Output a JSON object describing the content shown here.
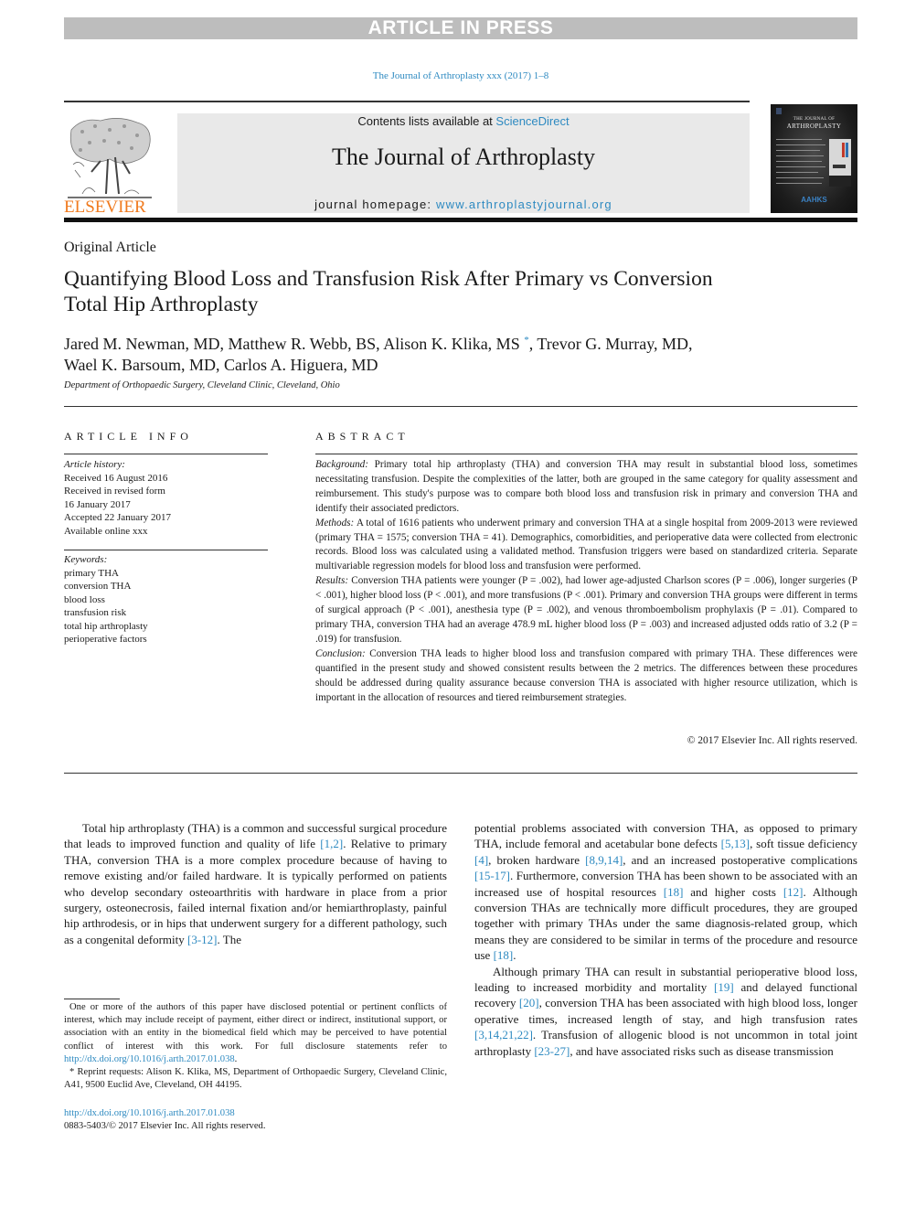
{
  "banner": {
    "text": "ARTICLE IN PRESS"
  },
  "journal_ref": "The Journal of Arthroplasty xxx (2017) 1–8",
  "masthead": {
    "publisher": "ELSEVIER",
    "contents_prefix": "Contents lists available at ",
    "contents_link": "ScienceDirect",
    "journal_name": "The Journal of Arthroplasty",
    "homepage_prefix": "journal homepage: ",
    "homepage_link": "www.arthroplastyjournal.org",
    "cover_title_1": "THE JOURNAL OF",
    "cover_title_2": "ARTHROPLASTY",
    "cover_society": "AAHKS"
  },
  "article": {
    "type": "Original Article",
    "title": "Quantifying Blood Loss and Transfusion Risk After Primary vs Conversion Total Hip Arthroplasty",
    "authors_line1_a": "Jared M. Newman, MD, Matthew R. Webb, BS, Alison K. Klika, MS ",
    "authors_mark": "*",
    "authors_line1_b": ", Trevor G. Murray, MD,",
    "authors_line2": "Wael K. Barsoum, MD,  Carlos A. Higuera, MD",
    "affiliation": "Department of Orthopaedic Surgery, Cleveland Clinic, Cleveland, Ohio"
  },
  "article_info": {
    "heading": "ARTICLE INFO",
    "history_label": "Article history:",
    "history": [
      "Received 16 August 2016",
      "Received in revised form",
      "16 January 2017",
      "Accepted 22 January 2017",
      "Available online xxx"
    ],
    "keywords_label": "Keywords:",
    "keywords": [
      "primary THA",
      "conversion THA",
      "blood loss",
      "transfusion risk",
      "total hip arthroplasty",
      "perioperative factors"
    ]
  },
  "abstract": {
    "heading": "ABSTRACT",
    "background_label": "Background:",
    "background": "Primary total hip arthroplasty (THA) and conversion THA may result in substantial blood loss, sometimes necessitating transfusion. Despite the complexities of the latter, both are grouped in the same category for quality assessment and reimbursement. This study's purpose was to compare both blood loss and transfusion risk in primary and conversion THA and identify their associated predictors.",
    "methods_label": "Methods:",
    "methods": "A total of 1616 patients who underwent primary and conversion THA at a single hospital from 2009-2013 were reviewed (primary THA = 1575; conversion THA = 41). Demographics, comorbidities, and perioperative data were collected from electronic records. Blood loss was calculated using a validated method. Transfusion triggers were based on standardized criteria. Separate multivariable regression models for blood loss and transfusion were performed.",
    "results_label": "Results:",
    "results": "Conversion THA patients were younger (P = .002), had lower age-adjusted Charlson scores (P = .006), longer surgeries (P < .001), higher blood loss (P < .001), and more transfusions (P < .001). Primary and conversion THA groups were different in terms of surgical approach (P < .001), anesthesia type (P = .002), and venous thromboembolism prophylaxis (P = .01). Compared to primary THA, conversion THA had an average 478.9 mL higher blood loss (P = .003) and increased adjusted odds ratio of 3.2 (P = .019) for transfusion.",
    "conclusion_label": "Conclusion:",
    "conclusion": "Conversion THA leads to higher blood loss and transfusion compared with primary THA. These differences were quantified in the present study and showed consistent results between the 2 metrics. The differences between these procedures should be addressed during quality assurance because conversion THA is associated with higher resource utilization, which is important in the allocation of resources and tiered reimbursement strategies.",
    "copyright": "© 2017 Elsevier Inc. All rights reserved."
  },
  "body": {
    "left_p1": [
      {
        "t": "Total hip arthroplasty (THA) is a common and successful surgical procedure that leads to improved function and quality of life "
      },
      {
        "ref": "[1,2]"
      },
      {
        "t": ". Relative to primary THA, conversion THA is a more complex procedure because of having to remove existing and/or failed hardware. It is typically performed on patients who develop secondary osteoarthritis with hardware in place from a prior surgery, osteonecrosis, failed internal fixation and/or hemiarthroplasty, painful hip arthrodesis, or in hips that underwent surgery for a different pathology, such as a congenital deformity "
      },
      {
        "ref": "[3-12]"
      },
      {
        "t": ". The"
      }
    ],
    "right_p1": [
      {
        "t": "potential problems associated with conversion THA, as opposed to primary THA, include femoral and acetabular bone defects "
      },
      {
        "ref": "[5,13]"
      },
      {
        "t": ", soft tissue deficiency "
      },
      {
        "ref": "[4]"
      },
      {
        "t": ", broken hardware "
      },
      {
        "ref": "[8,9,14]"
      },
      {
        "t": ", and an increased postoperative complications "
      },
      {
        "ref": "[15-17]"
      },
      {
        "t": ". Furthermore, conversion THA has been shown to be associated with an increased use of hospital resources "
      },
      {
        "ref": "[18]"
      },
      {
        "t": " and higher costs "
      },
      {
        "ref": "[12]"
      },
      {
        "t": ". Although conversion THAs are technically more difficult procedures, they are grouped together with primary THAs under the same diagnosis-related group, which means they are considered to be similar in terms of the procedure and resource use "
      },
      {
        "ref": "[18]"
      },
      {
        "t": "."
      }
    ],
    "right_p2": [
      {
        "t": "Although primary THA can result in substantial perioperative blood loss, leading to increased morbidity and mortality "
      },
      {
        "ref": "[19]"
      },
      {
        "t": " and delayed functional recovery "
      },
      {
        "ref": "[20]"
      },
      {
        "t": ", conversion THA has been associated with high blood loss, longer operative times, increased length of stay, and high transfusion rates "
      },
      {
        "ref": "[3,14,21,22]"
      },
      {
        "t": ". Transfusion of allogenic blood is not uncommon in total joint arthroplasty "
      },
      {
        "ref": "[23-27]"
      },
      {
        "t": ", and have associated risks such as disease transmission"
      }
    ]
  },
  "footnotes": {
    "coi_text": "One or more of the authors of this paper have disclosed potential or pertinent conflicts of interest, which may include receipt of payment, either direct or indirect, institutional support, or association with an entity in the biomedical field which may be perceived to have potential conflict of interest with this work. For full disclosure statements refer to ",
    "coi_link": "http://dx.doi.org/10.1016/j.arth.2017.01.038",
    "coi_end": ".",
    "reprint": "* Reprint requests: Alison K. Klika, MS, Department of Orthopaedic Surgery, Cleveland Clinic, A41, 9500 Euclid Ave, Cleveland, OH 44195."
  },
  "footer": {
    "doi": "http://dx.doi.org/10.1016/j.arth.2017.01.038",
    "issn": "0883-5403/© 2017 Elsevier Inc. All rights reserved."
  },
  "colors": {
    "link": "#2e8ac1",
    "elsevier_orange": "#f07a1e",
    "banner_gray": "#bdbdbd",
    "masthead_gray": "#e9e9e9"
  }
}
